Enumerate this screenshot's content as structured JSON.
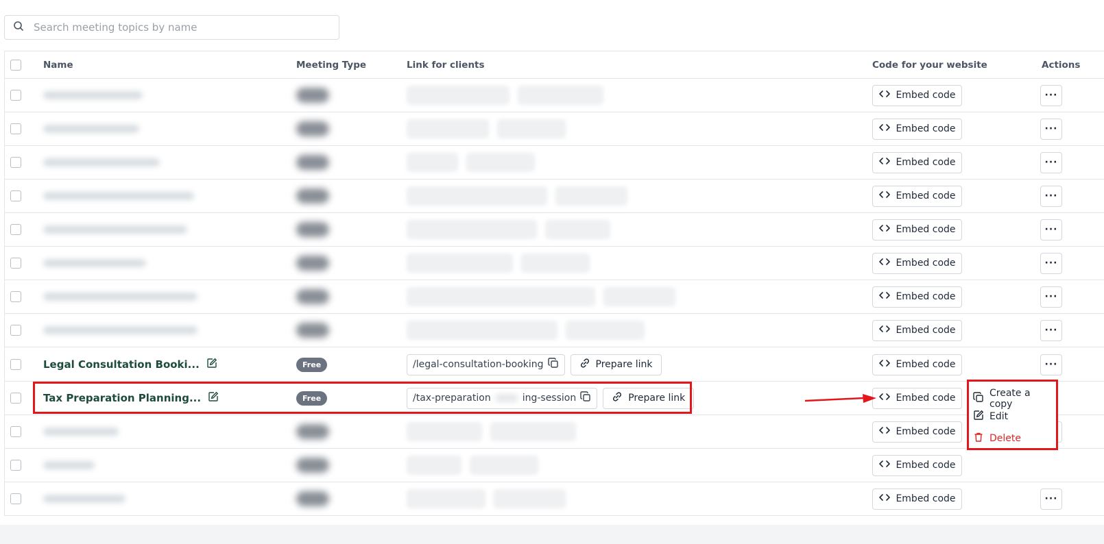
{
  "search": {
    "placeholder": "Search meeting topics by name"
  },
  "table": {
    "columns": {
      "name": "Name",
      "meeting_type": "Meeting Type",
      "link": "Link for clients",
      "code": "Code for your website",
      "actions": "Actions"
    },
    "embed_label": "Embed code",
    "prepare_link_label": "Prepare link",
    "rows": [
      {
        "name": "Legal Consultation Booki...",
        "type": "Free",
        "slug": "/legal-consultation-booking"
      },
      {
        "name": "Tax Preparation Planning...",
        "type": "Free",
        "slug_start": "/tax-preparation",
        "slug_end": "ing-session"
      }
    ]
  },
  "context_menu": {
    "items": [
      "Create a copy",
      "Edit",
      "Delete"
    ]
  },
  "colors": {
    "highlight": "#e3161b",
    "danger": "#dc2626",
    "name_text": "#1d4b3d"
  }
}
